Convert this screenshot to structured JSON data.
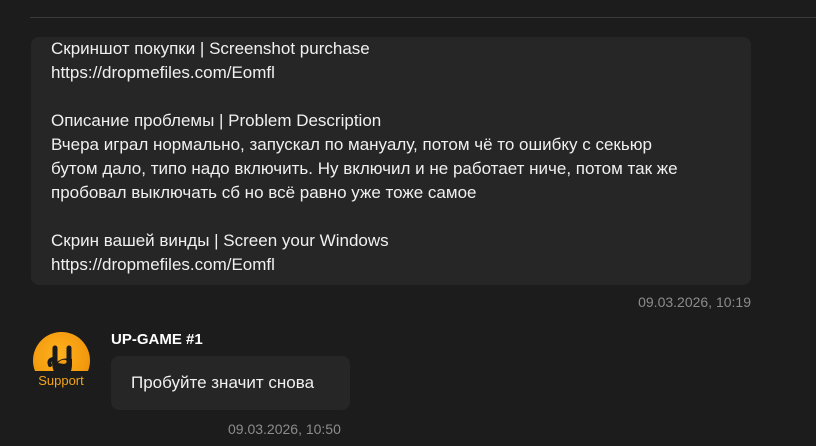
{
  "user_message": {
    "lines": [
      "Скриншот покупки | Screenshot purchase",
      "https://dropmefiles.com/Eomfl",
      "",
      "Описание проблемы | Problem Description",
      "Вчера играл нормально, запускал по мануалу, потом чё то ошибку с секьюр",
      "бутом дало, типо надо включить. Ну включил и не работает ниче, потом так же",
      "пробовал выключать сб но всё равно уже тоже самое",
      "",
      "Скрин вашей винды | Screen your Windows",
      "https://dropmefiles.com/Eomfl"
    ],
    "timestamp": "09.03.2026, 10:19"
  },
  "support_message": {
    "sender": "UP-GAME #1",
    "badge": "Support",
    "avatar_icon": "rock-hand-icon",
    "text": "Пробуйте значит снова",
    "timestamp": "09.03.2026, 10:50"
  },
  "colors": {
    "background": "#1c1c1c",
    "bubble": "#262626",
    "accent": "#f3a41a",
    "text": "#f0f0f0",
    "muted": "#8c8c8c"
  }
}
